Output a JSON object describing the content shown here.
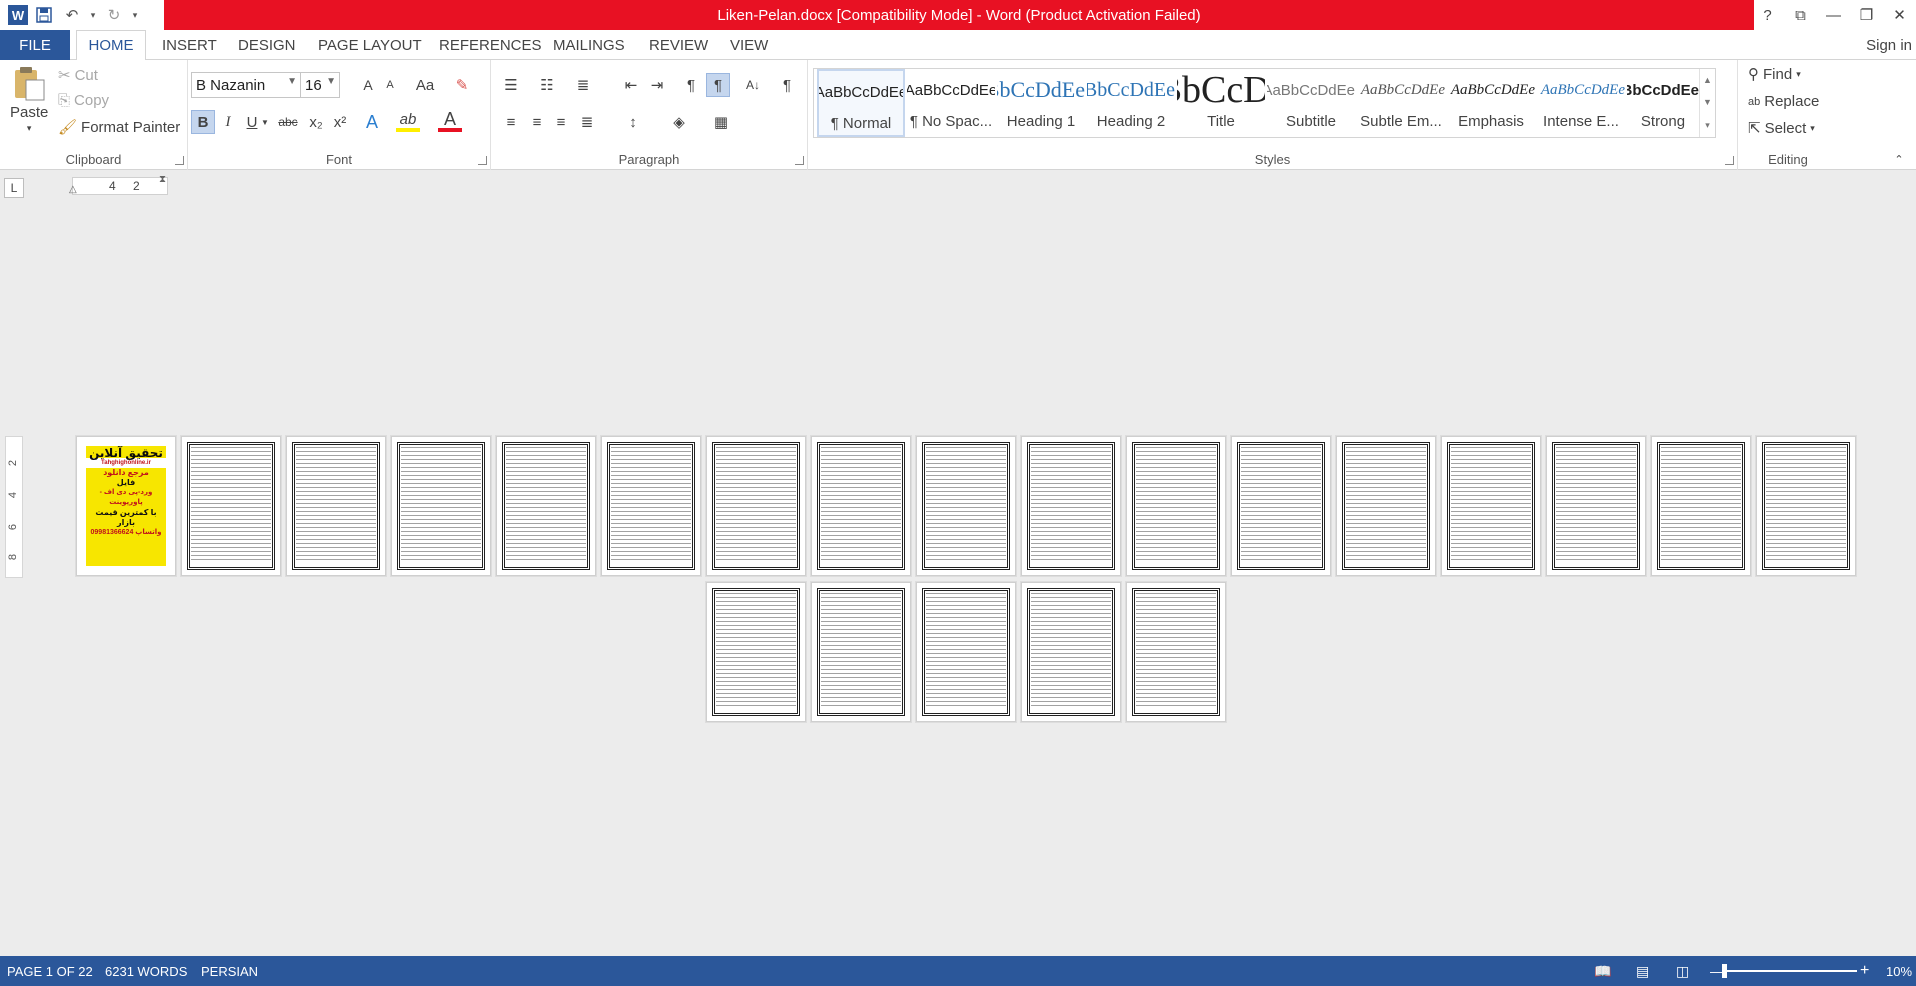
{
  "titlebar": {
    "title": "Liken-Pelan.docx [Compatibility Mode] -  Word (Product Activation Failed)",
    "help": "?",
    "controls": [
      "⧉",
      "—",
      "❐",
      "✕"
    ]
  },
  "qat": {
    "word": "W",
    "save": "💾",
    "undo": "↶",
    "undo_more": "▾",
    "redo": "↻",
    "customize": "▾"
  },
  "tabs": [
    "FILE",
    "HOME",
    "INSERT",
    "DESIGN",
    "PAGE LAYOUT",
    "REFERENCES",
    "MAILINGS",
    "REVIEW",
    "VIEW"
  ],
  "signin": "Sign in",
  "clipboard": {
    "paste": "Paste",
    "cut": "Cut",
    "copy": "Copy",
    "format_painter": "Format Painter",
    "label": "Clipboard"
  },
  "font": {
    "name": "B Nazanin",
    "size": "16",
    "label": "Font",
    "grow": "A",
    "shrink": "A",
    "case": "Aa",
    "bold": "B",
    "italic": "I",
    "underline": "U",
    "strike": "abc",
    "sub": "x₂",
    "sup": "x²",
    "effects": "A",
    "highlight": "ab",
    "color": "A"
  },
  "paragraph": {
    "label": "Paragraph"
  },
  "styles": {
    "label": "Styles",
    "items": [
      {
        "preview": "AaBbCcDdEe",
        "name": "¶ Normal"
      },
      {
        "preview": "AaBbCcDdEe",
        "name": "¶ No Spac..."
      },
      {
        "preview": "AaBbCcDdEe",
        "name": "Heading 1"
      },
      {
        "preview": "AaBbCcDdEe",
        "name": "Heading 2"
      },
      {
        "preview": "AaBbCcDdEe",
        "name": "Title"
      },
      {
        "preview": "AaBbCcDdEe",
        "name": "Subtitle"
      },
      {
        "preview": "AaBbCcDdEe",
        "name": "Subtle Em..."
      },
      {
        "preview": "AaBbCcDdEe",
        "name": "Emphasis"
      },
      {
        "preview": "AaBbCcDdEe",
        "name": "Intense E..."
      },
      {
        "preview": "AaBbCcDdEe",
        "name": "Strong"
      }
    ]
  },
  "editing": {
    "find": "Find",
    "replace": "Replace",
    "select": "Select",
    "label": "Editing"
  },
  "ruler": {
    "tab": "L",
    "marks": [
      "4",
      "2"
    ]
  },
  "vruler": {
    "marks": [
      "2",
      "4",
      "6",
      "8"
    ]
  },
  "cover_page": {
    "lines": [
      "تحقیق آنلاین",
      "Tahghighonline.ir",
      "مرجع دانلود",
      "فایل",
      "ورد-پی دی اف - پاورپوینت",
      "با کمترین قیمت بازار",
      "09981366624 واتساپ"
    ]
  },
  "status": {
    "page": "PAGE 1 OF 22",
    "words": "6231 WORDS",
    "language": "PERSIAN",
    "zoom_out": "—",
    "zoom_in": "+",
    "zoom": "10%"
  },
  "colors": {
    "word_blue": "#2b579a",
    "alert_red": "#e81123",
    "cover_yellow": "#f7e600"
  }
}
